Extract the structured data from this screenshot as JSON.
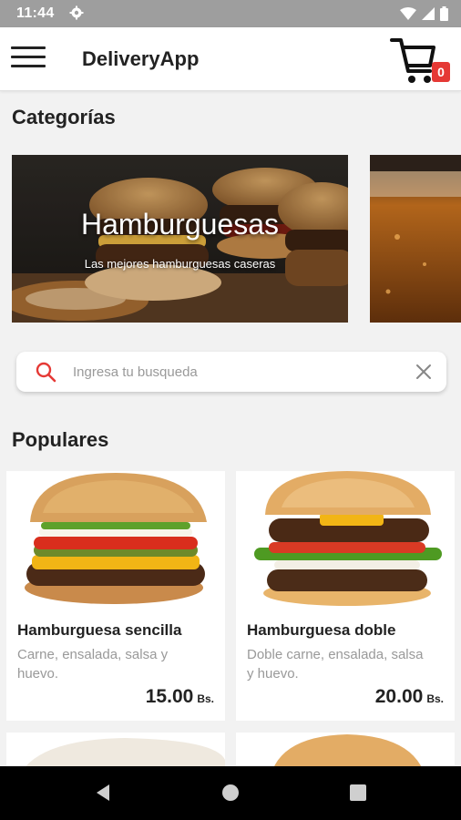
{
  "status_bar": {
    "time": "11:44",
    "icons": [
      "gear-icon",
      "wifi-icon",
      "signal-icon",
      "battery-icon"
    ]
  },
  "app_bar": {
    "title": "DeliveryApp",
    "cart_count": "0",
    "icons": [
      "menu-icon",
      "cart-icon"
    ]
  },
  "categories": {
    "title": "Categorías",
    "items": [
      {
        "title": "Hamburguesas",
        "subtitle": "Las mejores hamburguesas caseras"
      }
    ]
  },
  "search": {
    "placeholder": "Ingresa tu busqueda",
    "value": ""
  },
  "populares": {
    "title": "Populares",
    "items": [
      {
        "name": "Hamburguesa sencilla",
        "description": "Carne, ensalada, salsa y huevo.",
        "price": "15.00",
        "currency": "Bs."
      },
      {
        "name": "Hamburguesa doble",
        "description": "Doble carne, ensalada, salsa y huevo.",
        "price": "20.00",
        "currency": "Bs."
      }
    ]
  },
  "nav_bar": {
    "icons": [
      "back-icon",
      "home-icon",
      "recents-icon"
    ]
  },
  "colors": {
    "accent": "#e53935",
    "status_bar": "#9e9e9e",
    "background": "#f2f2f2"
  }
}
